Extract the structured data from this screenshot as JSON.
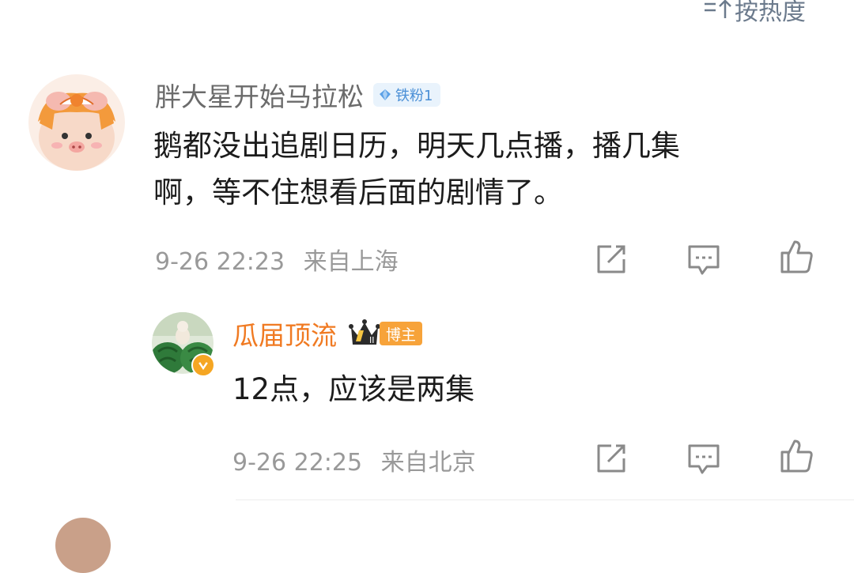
{
  "sort": {
    "label": "按热度",
    "icon": "sort-icon"
  },
  "comment": {
    "username": "胖大星开始马拉松",
    "fan_badge": "铁粉1",
    "text_line1": "鹅都没出追剧日历，明天几点播，播几集",
    "text_line2": "啊，等不住想看后面的剧情了。",
    "time": "9-26 22:23",
    "location": "来自上海"
  },
  "reply": {
    "username": "瓜届顶流",
    "crown_level": "II",
    "host_badge": "博主",
    "text": "12点，应该是两集",
    "time": "9-26 22:25",
    "location": "来自北京"
  },
  "colors": {
    "accent_orange": "#f07a22",
    "fan_blue": "#4a8fd6",
    "meta_gray": "#999999"
  }
}
